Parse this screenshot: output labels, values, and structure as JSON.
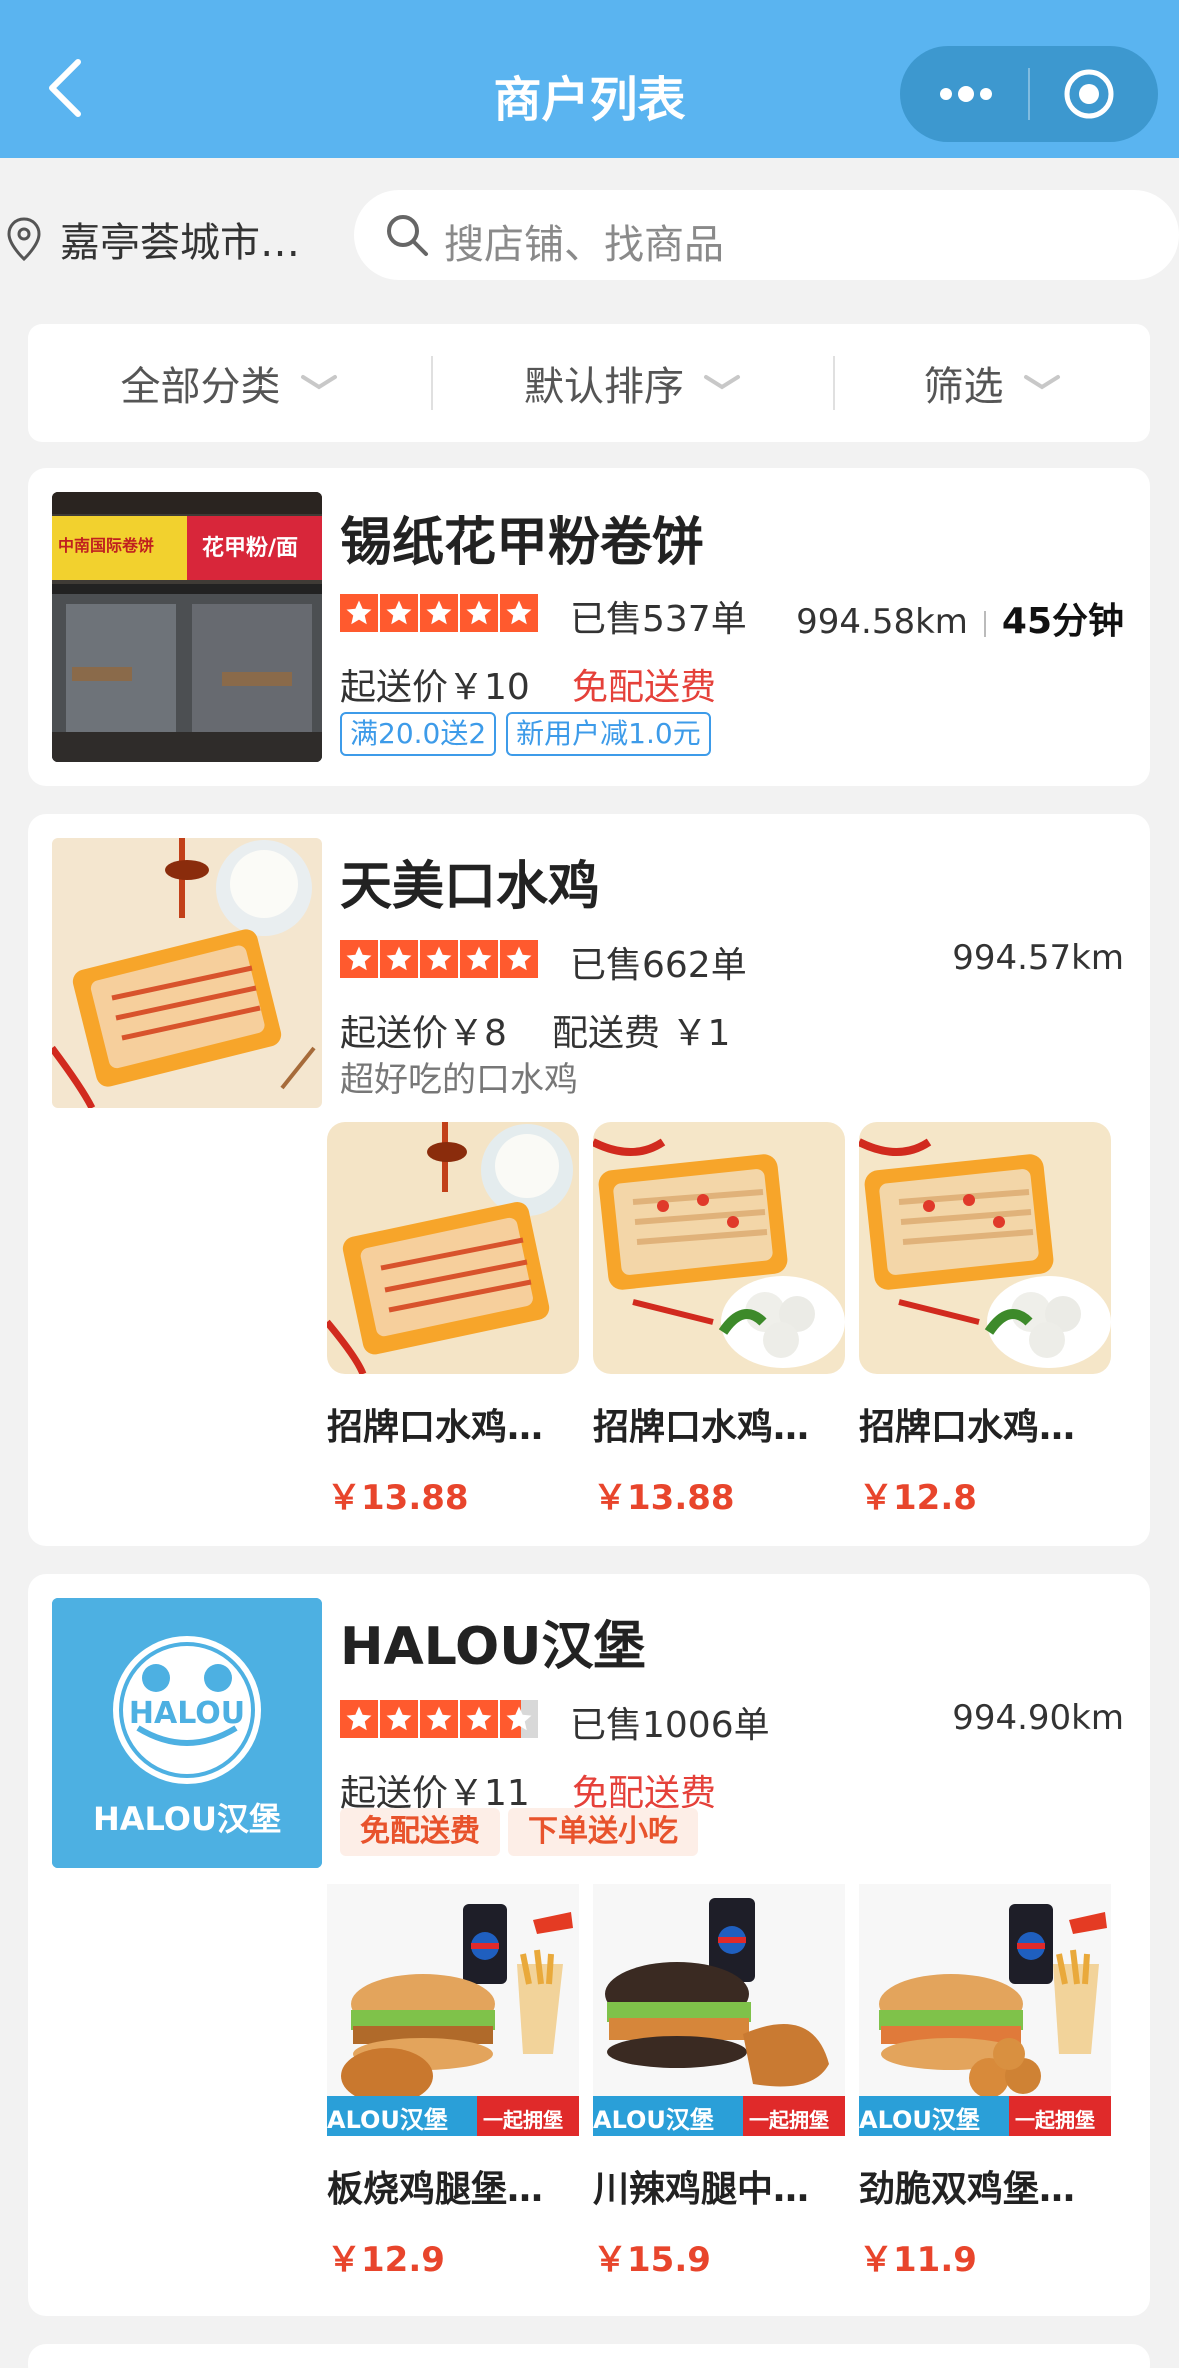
{
  "header": {
    "title": "商户列表",
    "back_icon": "chevron-left-icon",
    "more_icon": "more-dots-icon",
    "record_icon": "target-icon"
  },
  "location": {
    "text": "嘉亭荟城市…",
    "icon": "location-pin-icon"
  },
  "search": {
    "placeholder": "搜店铺、找商品"
  },
  "filters": [
    {
      "label": "全部分类"
    },
    {
      "label": "默认排序"
    },
    {
      "label": "筛选"
    }
  ],
  "stores": [
    {
      "name": "锡纸花甲粉卷饼",
      "rating": 5,
      "sold": "已售537单",
      "distance": "994.58km",
      "time": "45分钟",
      "min_price": "起送价￥10",
      "delivery": "免配送费",
      "tags": [
        "满20.0送2",
        "新用户减1.0元"
      ],
      "thumb_text_left": "中南国际卷饼",
      "thumb_text_right": "花甲粉/面"
    },
    {
      "name": "天美口水鸡",
      "rating": 5,
      "sold": "已售662单",
      "distance": "994.57km",
      "min_price": "起送价￥8",
      "delivery": "配送费 ￥1",
      "desc": "超好吃的口水鸡",
      "goods": [
        {
          "name": "招牌口水鸡…",
          "price": "￥13.88"
        },
        {
          "name": "招牌口水鸡…",
          "price": "￥13.88"
        },
        {
          "name": "招牌口水鸡…",
          "price": "￥12.8"
        }
      ]
    },
    {
      "name": "HALOU汉堡",
      "rating": 4.5,
      "sold": "已售1006单",
      "distance": "994.90km",
      "min_price": "起送价￥11",
      "delivery": "免配送费",
      "promo_tags": [
        "免配送费",
        "下单送小吃"
      ],
      "logo_text": "HALOU",
      "logo_caption": "HALOU汉堡",
      "goods": [
        {
          "name": "板烧鸡腿堡…",
          "price": "￥12.9",
          "banner_left": "ALOU汉堡",
          "banner_right": "一起拥堡"
        },
        {
          "name": "川辣鸡腿中…",
          "price": "￥15.9",
          "banner_left": "ALOU汉堡",
          "banner_right": "一起拥堡"
        },
        {
          "name": "劲脆双鸡堡…",
          "price": "￥11.9",
          "banner_left": "ALOU汉堡",
          "banner_right": "一起拥堡"
        }
      ]
    }
  ],
  "colors": {
    "header": "#5ab4f0",
    "star": "#ff5a2e",
    "price": "#e8452c",
    "free_delivery": "#e5413a",
    "tag_blue": "#3d9be9"
  }
}
